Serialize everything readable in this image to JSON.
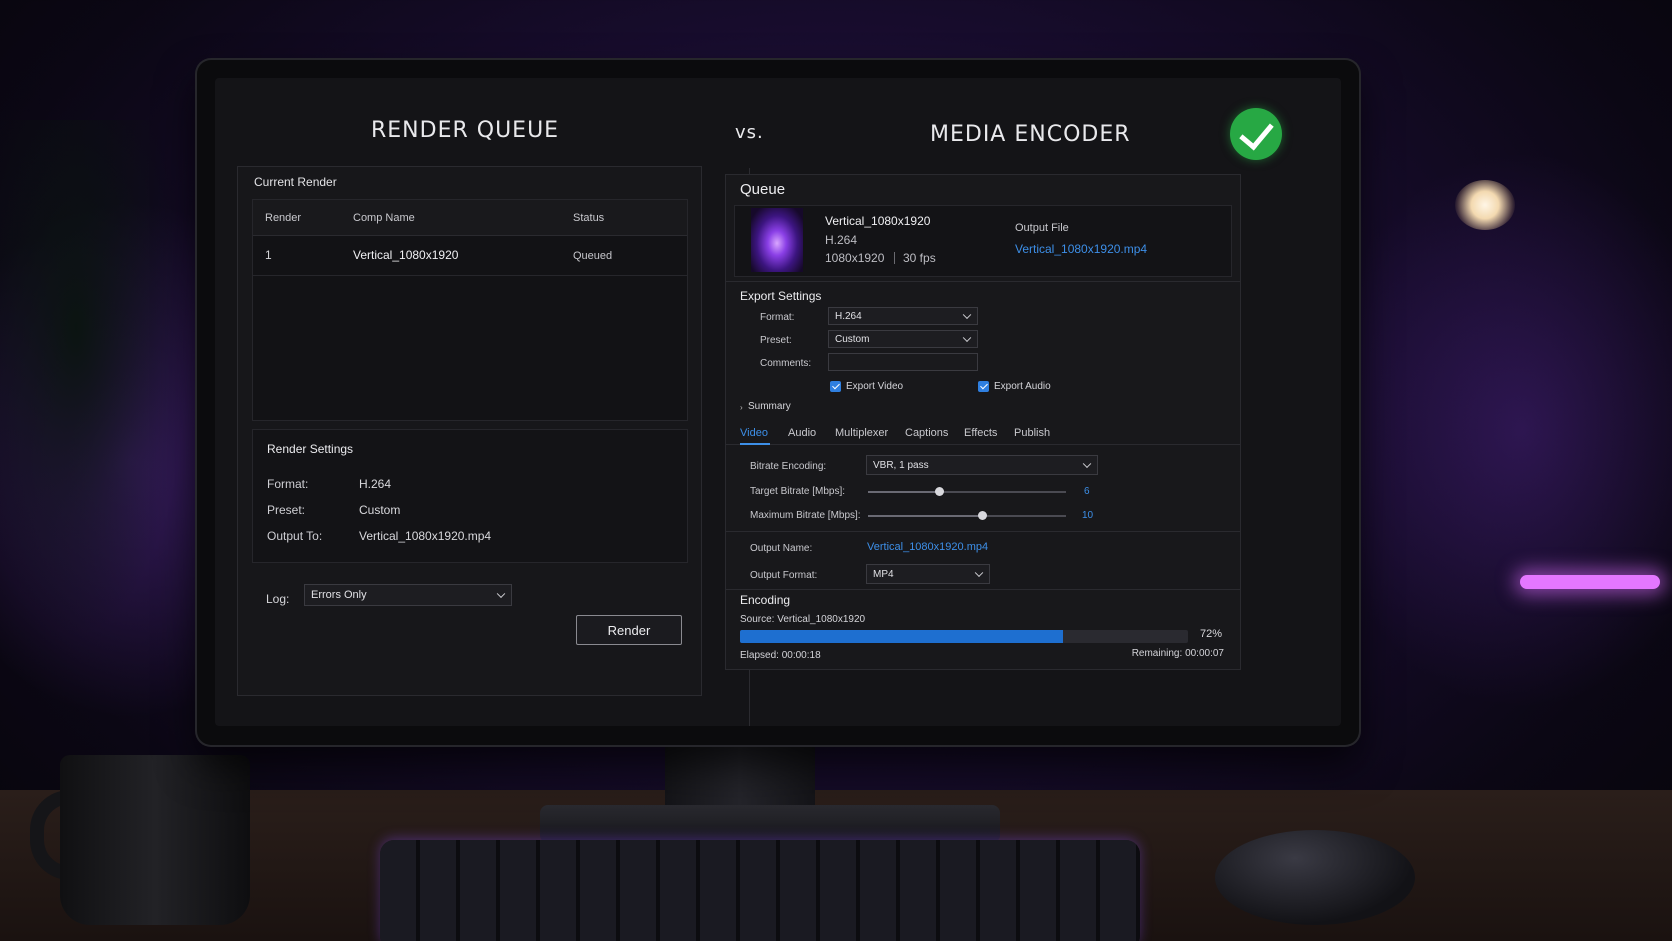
{
  "headings": {
    "left": "RENDER QUEUE",
    "vs": "vs.",
    "right": "MEDIA ENCODER"
  },
  "render_queue": {
    "current_render_label": "Current Render",
    "columns": [
      "Render",
      "Comp Name",
      "Status"
    ],
    "rows": [
      {
        "render": "1",
        "comp_name": "Vertical_1080x1920",
        "status": "Queued"
      }
    ],
    "settings": {
      "title": "Render Settings",
      "format_label": "Format:",
      "format_value": "H.264",
      "preset_label": "Preset:",
      "preset_value": "Custom",
      "output_label": "Output To:",
      "output_value": "Vertical_1080x1920.mp4"
    },
    "log_label": "Log:",
    "log_value": "Errors Only",
    "render_button": "Render"
  },
  "media_encoder": {
    "queue_title": "Queue",
    "item": {
      "name": "Vertical_1080x1920",
      "codec": "H.264",
      "resolution": "1080x1920",
      "fps": "30 fps",
      "output_file_label": "Output File",
      "output_file": "Vertical_1080x1920.mp4"
    },
    "export_settings": {
      "title": "Export Settings",
      "format_label": "Format:",
      "format_value": "H.264",
      "preset_label": "Preset:",
      "preset_value": "Custom",
      "comments_label": "Comments:",
      "comments_value": "",
      "export_video_label": "Export Video",
      "export_video_checked": true,
      "export_audio_label": "Export Audio",
      "export_audio_checked": true,
      "summary_label": "Summary"
    },
    "tabs": [
      "Video",
      "Audio",
      "Multiplexer",
      "Captions",
      "Effects",
      "Publish"
    ],
    "active_tab": "Video",
    "video": {
      "bitrate_encoding_label": "Bitrate Encoding:",
      "bitrate_encoding_value": "VBR, 1 pass",
      "target_bitrate_label": "Target Bitrate [Mbps]:",
      "target_bitrate_value": "6",
      "target_bitrate_fraction": 0.36,
      "max_bitrate_label": "Maximum Bitrate [Mbps]:",
      "max_bitrate_value": "10",
      "max_bitrate_fraction": 0.58,
      "output_name_label": "Output Name:",
      "output_name_value": "Vertical_1080x1920.mp4",
      "output_format_label": "Output Format:",
      "output_format_value": "MP4"
    },
    "encoding": {
      "title": "Encoding",
      "source_label": "Source:",
      "source_value": "Vertical_1080x1920",
      "progress_percent": 72,
      "progress_label": "72%",
      "elapsed_label": "Elapsed:",
      "elapsed_value": "00:00:18",
      "remaining_label": "Remaining:",
      "remaining_value": "00:00:07"
    }
  },
  "colors": {
    "accent_blue": "#3d8fe8",
    "progress_blue": "#1e6fd0",
    "success_green": "#27a844"
  },
  "icons": {
    "success": "check-circle-icon",
    "dropdown": "chevron-down-icon",
    "checkbox": "checkbox-checked-icon"
  }
}
